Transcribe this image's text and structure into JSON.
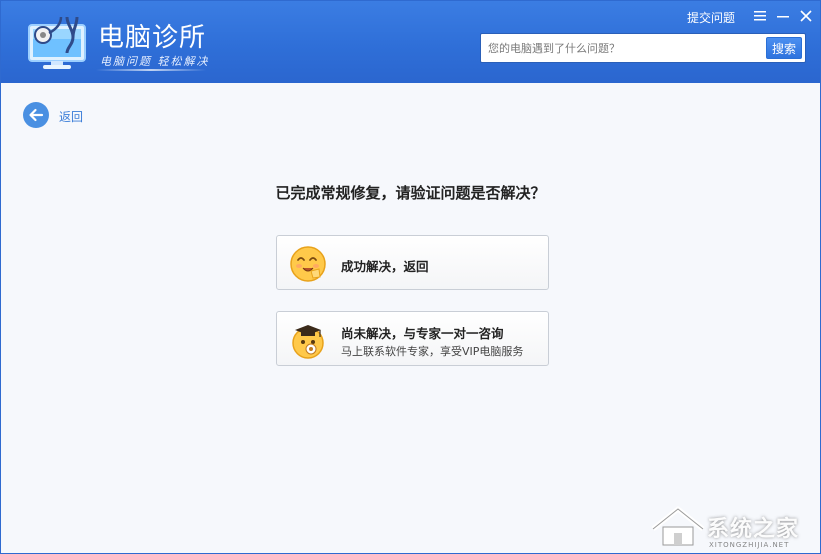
{
  "header": {
    "app_title": "电脑诊所",
    "slogan": "电脑问题 轻松解决",
    "submit_link": "提交问题",
    "search": {
      "placeholder": "您的电脑遇到了什么问题？",
      "button_label": "搜索"
    }
  },
  "nav": {
    "back_label": "返回"
  },
  "main": {
    "question": "已完成常规修复，请验证问题是否解决？",
    "options": [
      {
        "title": "成功解决，返回",
        "subtitle": ""
      },
      {
        "title": "尚未解决，与专家一对一咨询",
        "subtitle": "马上联系软件专家，享受VIP电脑服务"
      }
    ]
  },
  "watermark": {
    "text": "系统之家",
    "sub": "XITONGZHIJIA.NET"
  },
  "colors": {
    "header_blue": "#2f6fd8",
    "accent": "#4a90e2",
    "link": "#3b7dd8"
  }
}
